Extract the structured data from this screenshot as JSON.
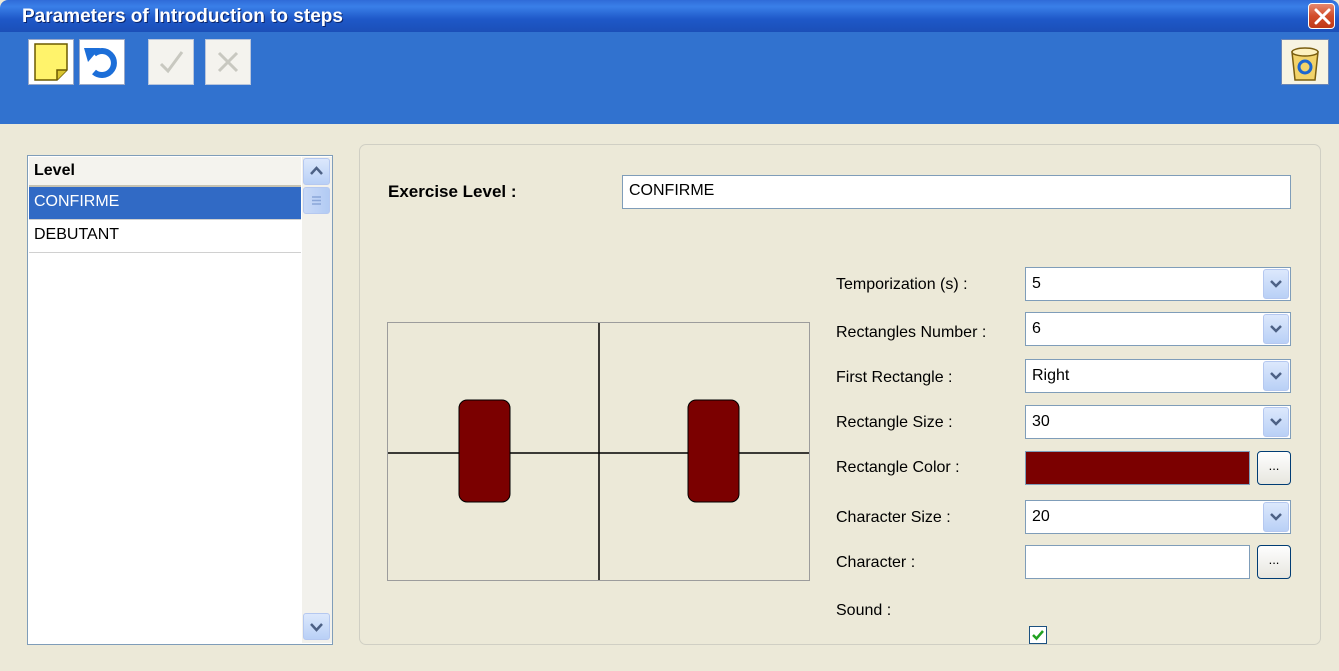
{
  "window": {
    "title": "Parameters of Introduction to steps"
  },
  "toolbar": {
    "buttons": [
      {
        "icon": "new-note-icon",
        "enabled": true
      },
      {
        "icon": "undo-icon",
        "enabled": true
      },
      {
        "icon": "checkmark-icon",
        "enabled": false
      },
      {
        "icon": "cancel-x-icon",
        "enabled": false
      }
    ],
    "trash_icon": "recycle-bin-icon"
  },
  "levels": {
    "header": "Level",
    "items": [
      "CONFIRME",
      "DEBUTANT"
    ],
    "selected": "CONFIRME"
  },
  "form": {
    "exercise_level_label": "Exercise Level :",
    "exercise_level_value": "CONFIRME",
    "temporization_label": "Temporization (s) :",
    "temporization_value": "5",
    "rect_number_label": "Rectangles Number :",
    "rect_number_value": "6",
    "first_rect_label": "First Rectangle :",
    "first_rect_value": "Right",
    "rect_size_label": "Rectangle Size :",
    "rect_size_value": "30",
    "rect_color_label": "Rectangle Color :",
    "rect_color_value": "#7b0000",
    "char_size_label": "Character Size :",
    "char_size_value": "20",
    "character_label": "Character :",
    "character_value": "",
    "sound_label": "Sound :",
    "sound_checked": true,
    "ellipsis": "..."
  },
  "colors": {
    "titlebar": "#1f5bc9",
    "toolbar": "#3172cf",
    "selection": "#316ac5",
    "rectangle": "#7b0000"
  }
}
